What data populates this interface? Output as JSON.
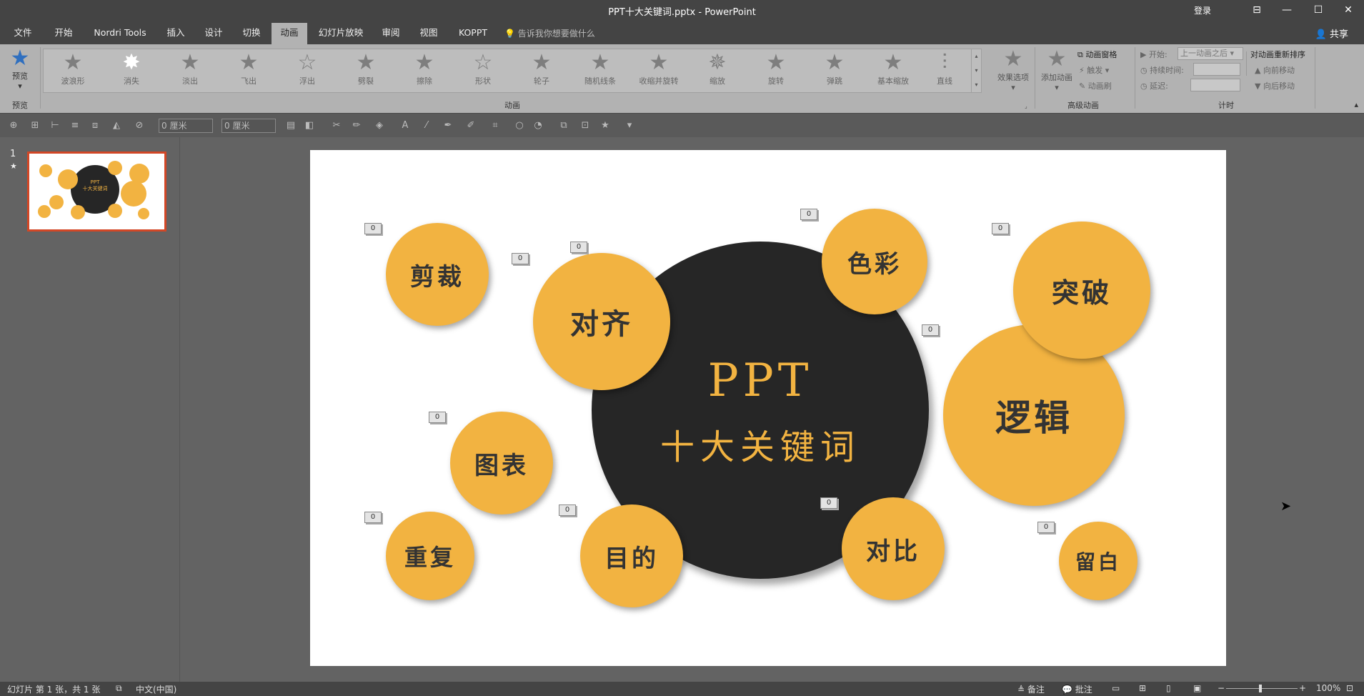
{
  "window": {
    "title": "PPT十大关键词.pptx  -  PowerPoint",
    "login": "登录",
    "controls": [
      "restore-ribbon-icon",
      "minimize-icon",
      "maximize-icon",
      "close-icon"
    ]
  },
  "tabs": [
    "文件",
    "开始",
    "Nordri Tools",
    "插入",
    "设计",
    "切换",
    "动画",
    "幻灯片放映",
    "审阅",
    "视图",
    "KOPPT"
  ],
  "active_tab": "动画",
  "tell_me": "告诉我你想要做什么",
  "share": "共享",
  "ribbon": {
    "preview": {
      "label": "预览",
      "group": "预览"
    },
    "animations": [
      "波浪形",
      "消失",
      "淡出",
      "飞出",
      "浮出",
      "劈裂",
      "擦除",
      "形状",
      "轮子",
      "随机线条",
      "收缩并旋转",
      "缩放",
      "旋转",
      "弹跳",
      "基本缩放",
      "直线"
    ],
    "animation_group": "动画",
    "effect_options": "效果选项",
    "add_animation": "添加动画",
    "animation_pane": "动画窗格",
    "trigger": "触发",
    "animation_painter": "动画刷",
    "advanced_group": "高级动画",
    "timing": {
      "start_label": "开始:",
      "start_value": "上一动画之后",
      "duration_label": "持续时间:",
      "delay_label": "延迟:",
      "group": "计时"
    },
    "reorder": {
      "title": "对动画重新排序",
      "earlier": "向前移动",
      "later": "向后移动"
    }
  },
  "qat": {
    "height_value": "0 厘米",
    "width_value": "0 厘米"
  },
  "thumbnails": {
    "slide_number": "1",
    "star": "★",
    "thumb_title_1": "PPT",
    "thumb_title_2": "十大关键词"
  },
  "slide": {
    "title_line1": "PPT",
    "title_line2": "十大关键词",
    "bubbles": {
      "jiancai": "剪裁",
      "duiqi": "对齐",
      "secai": "色彩",
      "tupo": "突破",
      "luoji": "逻辑",
      "tubiao": "图表",
      "chongfu": "重复",
      "mudi": "目的",
      "duibi": "对比",
      "liubai": "留白"
    },
    "tag_value": "0"
  },
  "status": {
    "slide_info": "幻灯片 第 1 张，共 1 张",
    "language": "中文(中国)",
    "notes": "备注",
    "comments": "批注",
    "zoom_minus": "−",
    "zoom_plus": "+",
    "zoom": "100%"
  }
}
